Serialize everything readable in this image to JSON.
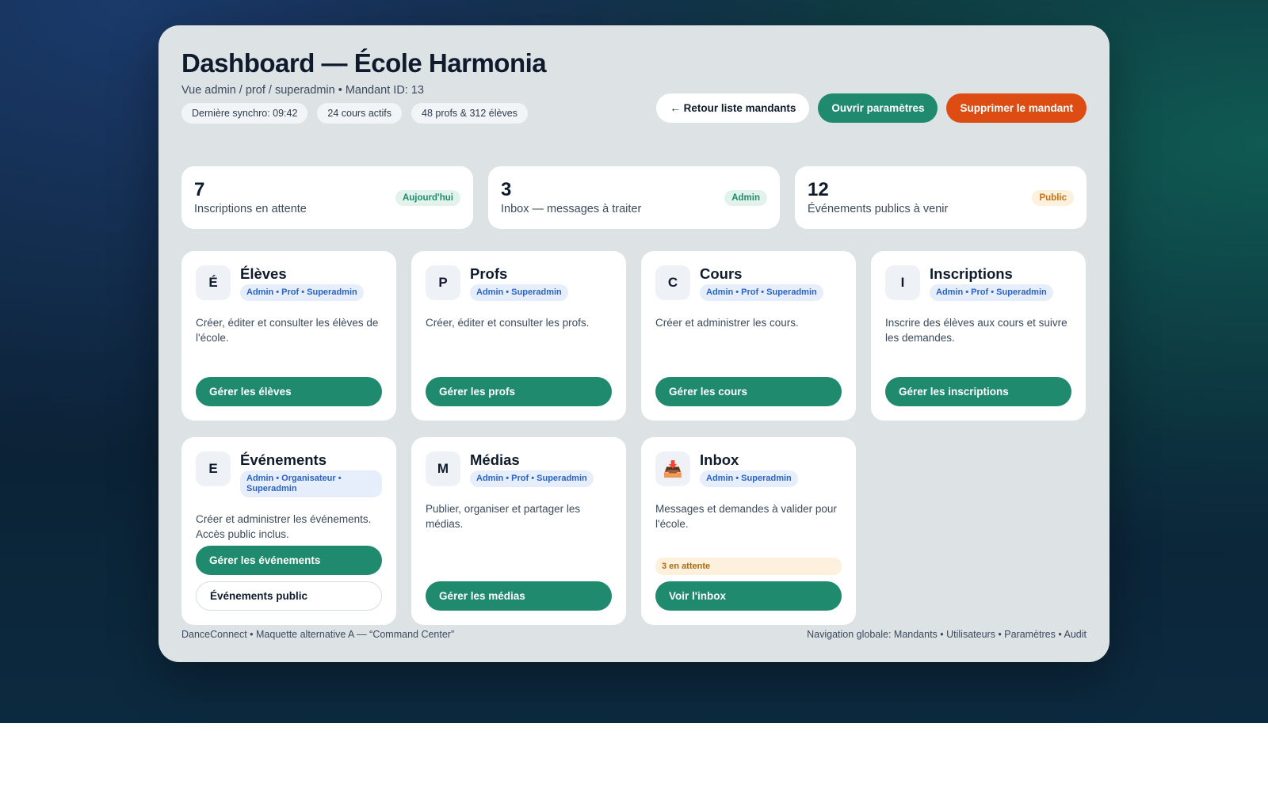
{
  "header": {
    "title": "Dashboard — École Harmonia",
    "subtitle": "Vue admin / prof / superadmin • Mandant ID: 13",
    "chips": [
      "Dernière synchro: 09:42",
      "24 cours actifs",
      "48 profs & 312 élèves"
    ],
    "actions": {
      "back": "← Retour liste mandants",
      "settings": "Ouvrir paramètres",
      "delete": "Supprimer le mandant"
    }
  },
  "stats": [
    {
      "value": "7",
      "label": "Inscriptions en attente",
      "badge": "Aujourd'hui",
      "badge_color": "#1f8a6e"
    },
    {
      "value": "3",
      "label": "Inbox — messages à traiter",
      "badge": "Admin",
      "badge_color": "#1f8a6e"
    },
    {
      "value": "12",
      "label": "Événements publics à venir",
      "badge": "Public",
      "badge_color": "#c27412"
    }
  ],
  "modules": [
    {
      "icon": "É",
      "title": "Élèves",
      "roles": "Admin • Prof • Superadmin",
      "desc": "Créer, éditer et consulter les élèves de l'école.",
      "primary": "Gérer les élèves"
    },
    {
      "icon": "P",
      "title": "Profs",
      "roles": "Admin • Superadmin",
      "desc": "Créer, éditer et consulter les profs.",
      "primary": "Gérer les profs"
    },
    {
      "icon": "C",
      "title": "Cours",
      "roles": "Admin • Prof • Superadmin",
      "desc": "Créer et administrer les cours.",
      "primary": "Gérer les cours"
    },
    {
      "icon": "I",
      "title": "Inscriptions",
      "roles": "Admin • Prof • Superadmin",
      "desc": "Inscrire des élèves aux cours et suivre les demandes.",
      "primary": "Gérer les inscriptions"
    },
    {
      "icon": "E",
      "title": "Événements",
      "roles": "Admin • Organisateur • Superadmin",
      "desc": "Créer et administrer les événements. Accès public inclus.",
      "primary": "Gérer les événements",
      "secondary": "Événements public"
    },
    {
      "icon": "M",
      "title": "Médias",
      "roles": "Admin • Prof • Superadmin",
      "desc": "Publier, organiser et partager les médias.",
      "primary": "Gérer les médias"
    },
    {
      "icon": "📥",
      "icon_name": "inbox-tray-icon",
      "title": "Inbox",
      "roles": "Admin • Superadmin",
      "desc": "Messages et demandes à valider pour l'école.",
      "pending": "3 en attente",
      "primary": "Voir l'inbox"
    }
  ],
  "footer": {
    "left": "DanceConnect • Maquette alternative A — “Command Center”",
    "right": "Navigation globale: Mandants • Utilisateurs • Paramètres • Audit"
  },
  "colors": {
    "accent": "#1f8a6e",
    "danger": "#dd4d13",
    "role_pill": "#2a63c8",
    "warning": "#c27412"
  }
}
